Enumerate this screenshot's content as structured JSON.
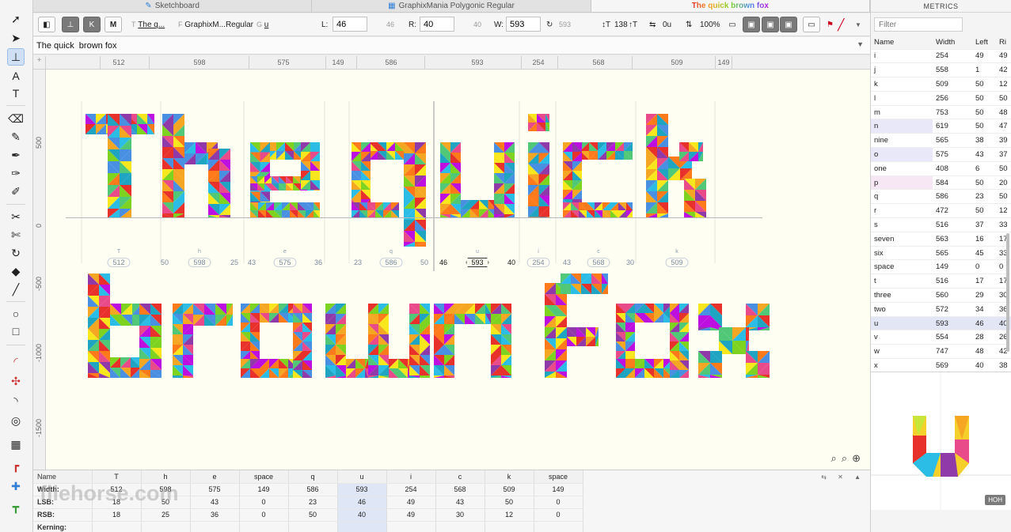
{
  "tabs": [
    {
      "label": "Sketchboard",
      "icon": "brush-icon"
    },
    {
      "label": "GraphixMania Polygonic Regular",
      "icon": "grid-icon"
    },
    {
      "label": "The quick brown fox",
      "icon": ""
    }
  ],
  "topbar": {
    "text_label": "T",
    "text_short": "The q...",
    "font_label": "F",
    "font_short": "GraphixM...Regular",
    "glyph_label": "G",
    "glyph_value": "u",
    "L_label": "L:",
    "L_value": "46",
    "L_gray": "46",
    "R_label": "R:",
    "R_value": "40",
    "R_gray": "40",
    "W_label": "W:",
    "W_value": "593",
    "W_gray": "593",
    "tracking_value": "138",
    "kern_value": "0u",
    "zoom_value": "100%"
  },
  "textline": {
    "value": "The quick  brown fox"
  },
  "hruler": {
    "labels": [
      "512",
      "598",
      "575",
      "149",
      "586",
      "593",
      "254",
      "568",
      "509",
      "149"
    ]
  },
  "vruler": {
    "labels": [
      "500",
      "0",
      "-500",
      "-1000",
      "-1500"
    ]
  },
  "glyph_row": [
    {
      "char": "T",
      "lsb": "",
      "width": "512",
      "rsb": ""
    },
    {
      "char": "h",
      "lsb": "50",
      "width": "598",
      "rsb": "25"
    },
    {
      "char": "e",
      "lsb": "43",
      "width": "575",
      "rsb": "36"
    },
    {
      "char": "q",
      "lsb": "23",
      "width": "586",
      "rsb": "50"
    },
    {
      "char": "u",
      "lsb": "46",
      "width": "593",
      "rsb": "40"
    },
    {
      "char": "i",
      "lsb": "",
      "width": "254",
      "rsb": "43"
    },
    {
      "char": "c",
      "lsb": "",
      "width": "568",
      "rsb": "30"
    },
    {
      "char": "k",
      "lsb": "",
      "width": "509",
      "rsb": ""
    }
  ],
  "bottom_table": {
    "rows": [
      {
        "label": "Name",
        "cells": [
          "T",
          "h",
          "e",
          "space",
          "q",
          "u",
          "i",
          "c",
          "k",
          "space"
        ]
      },
      {
        "label": "Width:",
        "cells": [
          "512",
          "598",
          "575",
          "149",
          "586",
          "593",
          "254",
          "568",
          "509",
          "149"
        ]
      },
      {
        "label": "LSB:",
        "cells": [
          "18",
          "50",
          "43",
          "0",
          "23",
          "46",
          "49",
          "43",
          "50",
          "0"
        ]
      },
      {
        "label": "RSB:",
        "cells": [
          "18",
          "25",
          "36",
          "0",
          "50",
          "40",
          "49",
          "30",
          "12",
          "0"
        ]
      },
      {
        "label": "Kerning:",
        "cells": [
          "",
          "",
          "",
          "",
          "",
          "",
          "",
          "",
          "",
          ""
        ]
      }
    ],
    "controls": "⇆ ✕ ▲"
  },
  "watermark": "filehorse.com",
  "metrics": {
    "title": "METRICS",
    "filter_placeholder": "Filter",
    "headers": [
      "Name",
      "Width",
      "Left",
      "Ri"
    ],
    "rows": [
      [
        "i",
        "254",
        "49",
        "49"
      ],
      [
        "j",
        "558",
        "1",
        "42"
      ],
      [
        "k",
        "509",
        "50",
        "12"
      ],
      [
        "l",
        "256",
        "50",
        "50"
      ],
      [
        "m",
        "753",
        "50",
        "48"
      ],
      [
        "n",
        "619",
        "50",
        "47"
      ],
      [
        "nine",
        "565",
        "38",
        "39"
      ],
      [
        "o",
        "575",
        "43",
        "37"
      ],
      [
        "one",
        "408",
        "6",
        "50"
      ],
      [
        "p",
        "584",
        "50",
        "20"
      ],
      [
        "q",
        "586",
        "23",
        "50"
      ],
      [
        "r",
        "472",
        "50",
        "12"
      ],
      [
        "s",
        "516",
        "37",
        "33"
      ],
      [
        "seven",
        "563",
        "16",
        "17"
      ],
      [
        "six",
        "565",
        "45",
        "33"
      ],
      [
        "space",
        "149",
        "0",
        "0"
      ],
      [
        "t",
        "516",
        "17",
        "17"
      ],
      [
        "three",
        "560",
        "29",
        "30"
      ],
      [
        "two",
        "572",
        "34",
        "36"
      ],
      [
        "u",
        "593",
        "46",
        "40"
      ],
      [
        "v",
        "554",
        "28",
        "26"
      ],
      [
        "w",
        "747",
        "48",
        "42"
      ],
      [
        "x",
        "569",
        "40",
        "38"
      ]
    ],
    "hoh_label": "HOH"
  }
}
